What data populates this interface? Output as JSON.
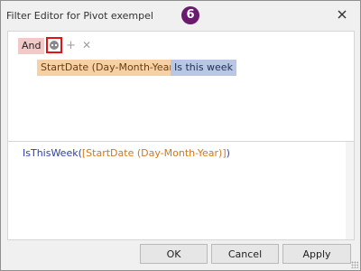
{
  "window": {
    "title": "Filter Editor for Pivot exempel",
    "step_badge": "6"
  },
  "tree": {
    "group_operator": "And",
    "condition": {
      "field": "StartDate (Day-Month-Year)",
      "operator": "Is this week"
    }
  },
  "expression": {
    "function": "IsThisWeek",
    "open": "(",
    "column": "[StartDate (Day-Month-Year)]",
    "close": ")"
  },
  "buttons": {
    "ok": "OK",
    "cancel": "Cancel",
    "apply": "Apply"
  },
  "icons": {
    "close": "close-icon",
    "group_menu": "group-options-icon",
    "add": "plus-icon",
    "remove": "remove-icon"
  },
  "colors": {
    "badge": "#6a1b6e",
    "and_chip": "#f2c9c7",
    "field_chip": "#f6d1a6",
    "operator_chip": "#b8c7e3",
    "highlight": "#e01414"
  }
}
